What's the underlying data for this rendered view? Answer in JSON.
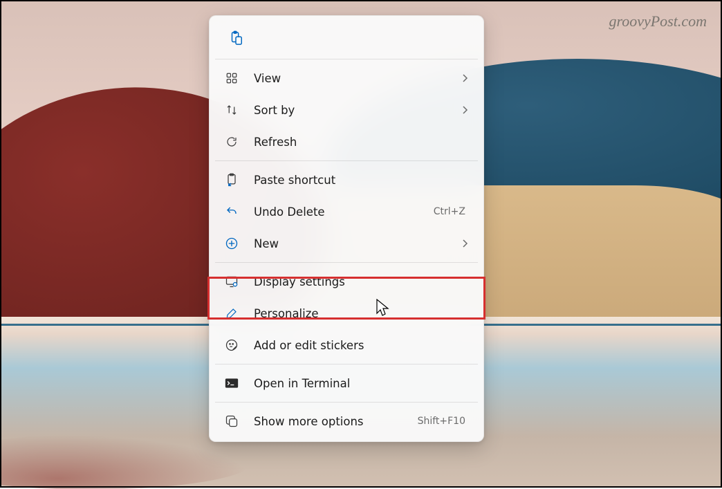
{
  "watermark": "groovyPost.com",
  "menu": {
    "view": {
      "label": "View",
      "has_submenu": true
    },
    "sort_by": {
      "label": "Sort by",
      "has_submenu": true
    },
    "refresh": {
      "label": "Refresh"
    },
    "paste_shortcut": {
      "label": "Paste shortcut"
    },
    "undo_delete": {
      "label": "Undo Delete",
      "shortcut": "Ctrl+Z"
    },
    "new": {
      "label": "New",
      "has_submenu": true
    },
    "display_settings": {
      "label": "Display settings"
    },
    "personalize": {
      "label": "Personalize"
    },
    "stickers": {
      "label": "Add or edit stickers"
    },
    "open_terminal": {
      "label": "Open in Terminal"
    },
    "show_more": {
      "label": "Show more options",
      "shortcut": "Shift+F10"
    }
  },
  "highlighted_item": "display_settings"
}
